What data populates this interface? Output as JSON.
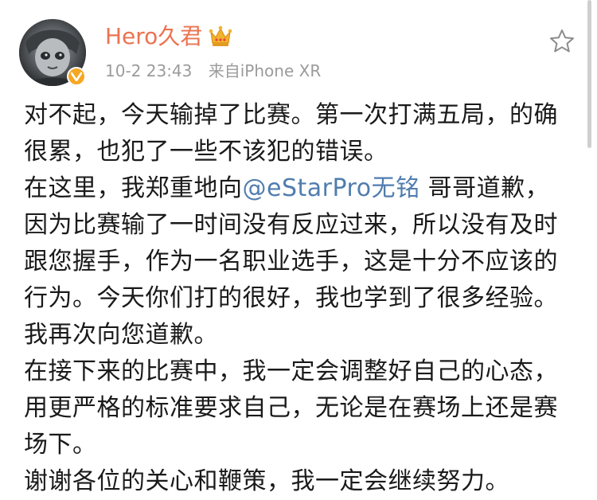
{
  "post": {
    "author": {
      "name": "Hero久君",
      "avatar_icon": "avatar-image",
      "verified_icon": "verified-badge-icon",
      "member_icon": "crown-icon",
      "name_color": "#eb7350"
    },
    "meta": {
      "time": "10-2 23:43",
      "source": "来自iPhone XR"
    },
    "favorite_icon": "star-outline-icon",
    "paragraphs": [
      {
        "text": "对不起，今天输掉了比赛。第一次打满五局，的确很累，也犯了一些不该犯的错误。"
      },
      {
        "before": "在这里，我郑重地向",
        "mention": "@eStarPro无铭",
        "after": " 哥哥道歉，因为比赛输了一时间没有反应过来，所以没有及时跟您握手，作为一名职业选手，这是十分不应该的行为。今天你们打的很好，我也学到了很多经验。我再次向您道歉。"
      },
      {
        "text": "在接下来的比赛中，我一定会调整好自己的心态，用更严格的标准要求自己，无论是在赛场上还是赛场下。"
      },
      {
        "text": "谢谢各位的关心和鞭策，我一定会继续努力。"
      }
    ],
    "mention_color": "#507daf"
  }
}
